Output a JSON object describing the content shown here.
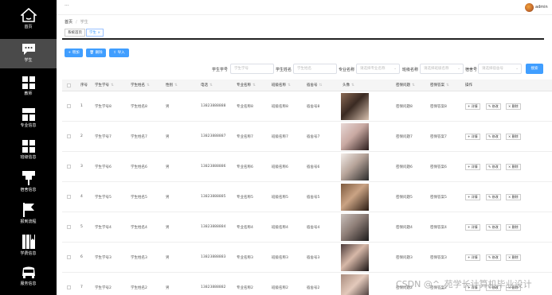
{
  "sidebar": {
    "items": [
      {
        "label": "首页",
        "icon": "home-icon",
        "active": false
      },
      {
        "label": "学生",
        "icon": "message-icon",
        "active": true
      },
      {
        "label": "教师",
        "icon": "grid-icon",
        "active": false
      },
      {
        "label": "专业信息",
        "icon": "folder-icon",
        "active": false
      },
      {
        "label": "班级信息",
        "icon": "grid-icon",
        "active": false
      },
      {
        "label": "宿舍信息",
        "icon": "pin-icon",
        "active": false
      },
      {
        "label": "报到流程",
        "icon": "flag-icon",
        "active": false
      },
      {
        "label": "学费信息",
        "icon": "book-icon",
        "active": false
      },
      {
        "label": "服务信息",
        "icon": "car-icon",
        "active": false
      }
    ]
  },
  "topbar": {
    "menu": "···",
    "username": "admin"
  },
  "breadcrumb": {
    "home": "首页",
    "sep": "/",
    "current": "学生"
  },
  "tags": [
    {
      "label": "系统首页",
      "type": "default"
    },
    {
      "label": "学生 ×",
      "type": "blue"
    }
  ],
  "toolbar": {
    "add": "+ 增加",
    "delete": "🗑 删除",
    "import": "⇪ 导入"
  },
  "search": {
    "fields": [
      {
        "label": "学生学号",
        "placeholder": "学生学号"
      },
      {
        "label": "学生姓名",
        "placeholder": "学生姓名"
      },
      {
        "label": "专业名称",
        "placeholder": "请选择专业名称"
      },
      {
        "label": "班级名称",
        "placeholder": "请选择班级名称"
      },
      {
        "label": "宿舍号",
        "placeholder": "请选择宿舍号"
      }
    ],
    "button": "搜索"
  },
  "table": {
    "columns": [
      "序号",
      "学生学号",
      "学生姓名",
      "性别",
      "电话",
      "专业名称",
      "班级名称",
      "宿舍号",
      "头像",
      "密保问题",
      "密保答案",
      "操作"
    ],
    "rows": [
      {
        "idx": "1",
        "no": "学生学号8",
        "name": "学生姓名8",
        "sex": "男",
        "phone": "13823888888",
        "major": "专业名称8",
        "cls": "班级名称8",
        "dorm": "宿舍号8",
        "q": "密保问题8",
        "a": "密保答案8"
      },
      {
        "idx": "2",
        "no": "学生学号7",
        "name": "学生姓名7",
        "sex": "男",
        "phone": "13823888887",
        "major": "专业名称7",
        "cls": "班级名称7",
        "dorm": "宿舍号7",
        "q": "密保问题7",
        "a": "密保答案7"
      },
      {
        "idx": "3",
        "no": "学生学号6",
        "name": "学生姓名6",
        "sex": "男",
        "phone": "13823888886",
        "major": "专业名称6",
        "cls": "班级名称6",
        "dorm": "宿舍号6",
        "q": "密保问题6",
        "a": "密保答案6"
      },
      {
        "idx": "4",
        "no": "学生学号5",
        "name": "学生姓名5",
        "sex": "男",
        "phone": "13823888885",
        "major": "专业名称5",
        "cls": "班级名称5",
        "dorm": "宿舍号5",
        "q": "密保问题5",
        "a": "密保答案5"
      },
      {
        "idx": "5",
        "no": "学生学号4",
        "name": "学生姓名4",
        "sex": "男",
        "phone": "13823888884",
        "major": "专业名称4",
        "cls": "班级名称4",
        "dorm": "宿舍号4",
        "q": "密保问题4",
        "a": "密保答案4"
      },
      {
        "idx": "6",
        "no": "学生学号3",
        "name": "学生姓名3",
        "sex": "男",
        "phone": "13823888883",
        "major": "专业名称3",
        "cls": "班级名称3",
        "dorm": "宿舍号3",
        "q": "密保问题3",
        "a": "密保答案3"
      },
      {
        "idx": "7",
        "no": "学生学号2",
        "name": "学生姓名2",
        "sex": "男",
        "phone": "13823888882",
        "major": "专业名称2",
        "cls": "班级名称2",
        "dorm": "宿舍号2",
        "q": "密保问题2",
        "a": "密保答案2"
      }
    ],
    "ops": {
      "detail": "+ 详情",
      "edit": "✎ 修改",
      "del": "× 删除"
    }
  },
  "watermark": "CSDN @^_苑学长计算机毕业设计",
  "colors": {
    "sidebar": "#000000",
    "active": "#4a4a4a",
    "primary": "#409eff"
  }
}
